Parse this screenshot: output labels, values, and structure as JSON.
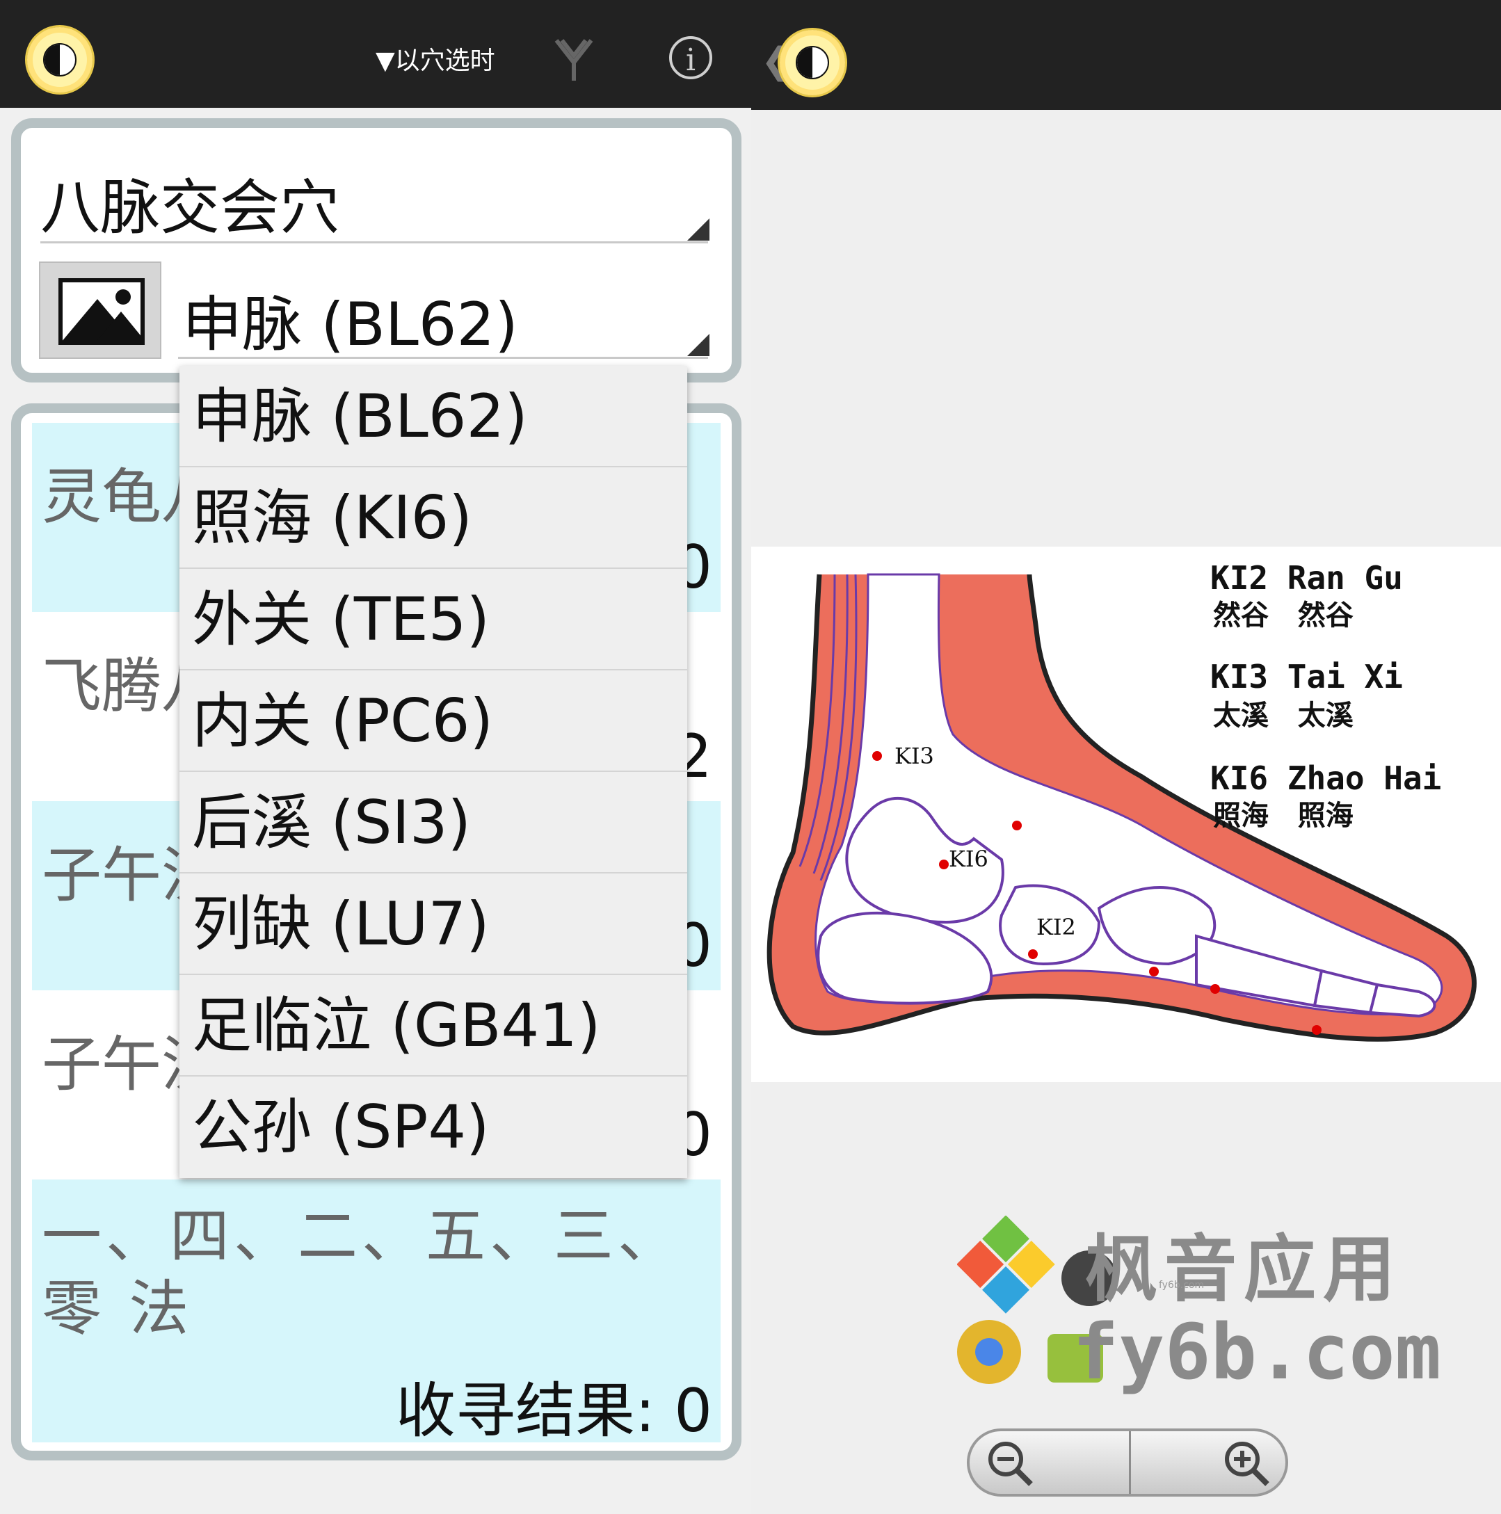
{
  "left": {
    "header": {
      "mode_label": "▼以穴选时",
      "nav_icon": "fork-icon",
      "info_label": "i"
    },
    "selector": {
      "category": "八脉交会穴",
      "selected_point": "申脉 (BL62)"
    },
    "dropdown_options": [
      "申脉 (BL62)",
      "照海 (KI6)",
      "外关 (TE5)",
      "内关 (PC6)",
      "后溪 (SI3)",
      "列缺 (LU7)",
      "足临泣 (GB41)",
      "公孙 (SP4)"
    ],
    "results": [
      {
        "label": "灵龟八",
        "result": "0"
      },
      {
        "label": "飞腾八",
        "result": "2"
      },
      {
        "label": "子午流",
        "result": "0"
      },
      {
        "label": "子午流",
        "result": "0"
      },
      {
        "label": "一、四、二、五、三、零 法",
        "result": "收寻结果: 0"
      }
    ]
  },
  "right": {
    "legend": [
      {
        "code": "KI2 Ran Gu",
        "cn": "然谷   然谷"
      },
      {
        "code": "KI3 Tai Xi",
        "cn": "太溪   太溪"
      },
      {
        "code": "KI6 Zhao Hai",
        "cn": "照海   照海"
      }
    ],
    "point_labels": [
      "KI3",
      "KI6",
      "KI2"
    ],
    "watermark": {
      "line1": "枫音应用",
      "line2": "fy6b.com",
      "small": "fy6b.com"
    },
    "zoom": {
      "out": "−",
      "in": "+"
    }
  }
}
